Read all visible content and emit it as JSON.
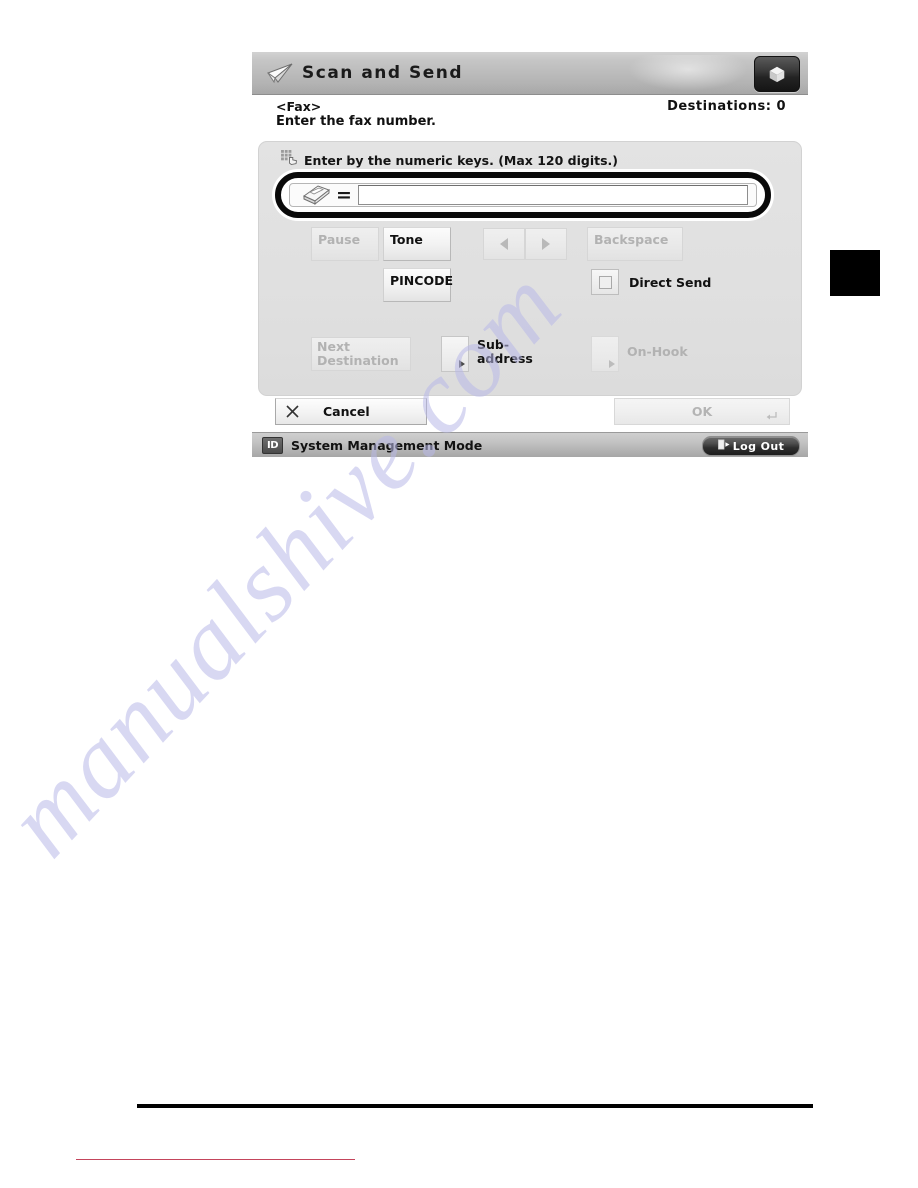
{
  "titlebar": {
    "title": "Scan and Send",
    "plane_icon": "paper-plane-icon",
    "cube_icon": "cube-icon"
  },
  "subheader": {
    "mode_tag": "<Fax>",
    "prompt": "Enter the fax number.",
    "destinations": "Destinations: 0"
  },
  "panel": {
    "hint_icon": "numeric-keypad-hand-icon",
    "hint": "Enter by the numeric keys. (Max 120 digits.)",
    "entry": {
      "fax_icon": "fax-machine-icon",
      "equals": "=",
      "value": "",
      "placeholder": ""
    },
    "keys": {
      "pause": "Pause",
      "tone": "Tone",
      "pincode": "PINCODE",
      "backspace": "Backspace",
      "arrow_left": "◀",
      "arrow_right": "▶",
      "next_destination_line1": "Next",
      "next_destination_line2": "Destination",
      "sub_address_line1": "Sub-",
      "sub_address_line2": "address",
      "on_hook": "On-Hook"
    },
    "direct_send": {
      "label": "Direct Send",
      "checked": false
    }
  },
  "actions": {
    "cancel": "Cancel",
    "cancel_icon": "close-x-icon",
    "ok": "OK",
    "ok_icon": "return-arrow-icon"
  },
  "statusbar": {
    "id_badge": "ID",
    "mode": "System Management Mode",
    "logout": "Log Out",
    "logout_icon": "logout-door-icon"
  },
  "page": {
    "watermark": "manualshive.com"
  },
  "colors": {
    "screen_border": "#8d8d8d",
    "titlebar_top": "#d2d2d2",
    "titlebar_bottom": "#a8a8a8",
    "panel_bg": "#e0e0e0",
    "highlight_ring": "#0a0a0a",
    "watermark": "#b9b9e8",
    "red_rule": "#c4455c"
  }
}
